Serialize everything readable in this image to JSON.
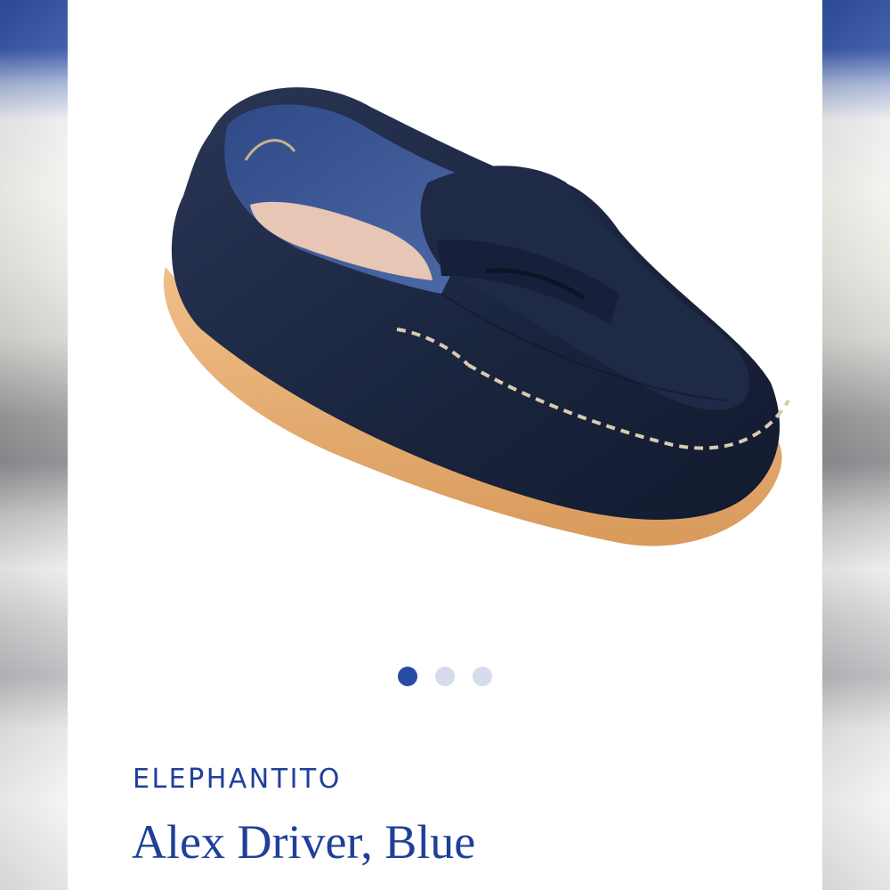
{
  "colors": {
    "accent": "#1f3f99",
    "dot_active": "#2a4ba3",
    "dot_inactive": "#d6dbee",
    "shoe_leather": "#1b2640",
    "sole": "#e0a768"
  },
  "product": {
    "image_icon": "navy-leather-penny-loafer-image",
    "brand": "ELEPHANTITO",
    "title": "Alex Driver, Blue"
  },
  "carousel": {
    "total": 3,
    "active_index": 1
  }
}
